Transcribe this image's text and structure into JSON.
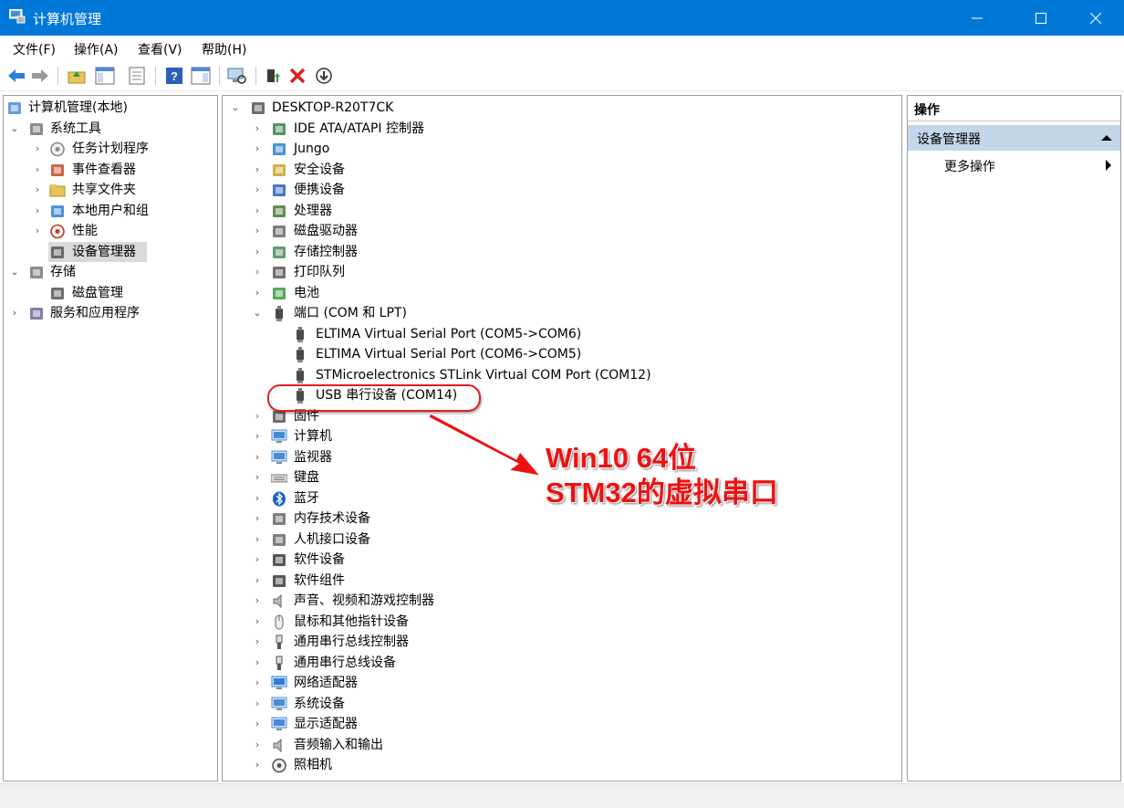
{
  "window": {
    "title": "计算机管理",
    "minimize": "—",
    "maximize": "☐",
    "close": "✕"
  },
  "menu": [
    "文件(F)",
    "操作(A)",
    "查看(V)",
    "帮助(H)"
  ],
  "toolbar": [
    "back-icon",
    "forward-icon",
    "up-folder-icon",
    "show-hide-tree-icon",
    "properties-icon",
    "help-icon",
    "show-action-pane-icon",
    "scan-hardware-icon",
    "update-driver-icon",
    "uninstall-icon",
    "disable-device-icon"
  ],
  "left_tree": [
    {
      "label": "计算机管理(本地)",
      "icon": "computer-management-icon",
      "level": 0,
      "chev": ""
    },
    {
      "label": "系统工具",
      "icon": "tools-icon",
      "level": 1,
      "chev": "⌄"
    },
    {
      "label": "任务计划程序",
      "icon": "clock-icon",
      "level": 2,
      "chev": "›"
    },
    {
      "label": "事件查看器",
      "icon": "event-viewer-icon",
      "level": 2,
      "chev": "›"
    },
    {
      "label": "共享文件夹",
      "icon": "shared-folder-icon",
      "level": 2,
      "chev": "›"
    },
    {
      "label": "本地用户和组",
      "icon": "users-icon",
      "level": 2,
      "chev": "›"
    },
    {
      "label": "性能",
      "icon": "performance-icon",
      "level": 2,
      "chev": "›"
    },
    {
      "label": "设备管理器",
      "icon": "device-manager-icon",
      "level": 2,
      "chev": "",
      "selected": true
    },
    {
      "label": "存储",
      "icon": "storage-icon",
      "level": 1,
      "chev": "⌄"
    },
    {
      "label": "磁盘管理",
      "icon": "disk-management-icon",
      "level": 2,
      "chev": ""
    },
    {
      "label": "服务和应用程序",
      "icon": "services-icon",
      "level": 1,
      "chev": "›"
    }
  ],
  "device_tree": {
    "root": {
      "label": "DESKTOP-R20T7CK",
      "icon": "desktop-computer-icon"
    },
    "categories_top": [
      {
        "label": "IDE ATA/ATAPI 控制器",
        "icon": "ide-controller-icon"
      },
      {
        "label": "Jungo",
        "icon": "jungo-icon"
      },
      {
        "label": "安全设备",
        "icon": "security-device-icon"
      },
      {
        "label": "便携设备",
        "icon": "portable-device-icon"
      },
      {
        "label": "处理器",
        "icon": "processor-icon"
      },
      {
        "label": "磁盘驱动器",
        "icon": "disk-drive-icon"
      },
      {
        "label": "存储控制器",
        "icon": "storage-controller-icon"
      },
      {
        "label": "打印队列",
        "icon": "printer-icon"
      },
      {
        "label": "电池",
        "icon": "battery-icon"
      }
    ],
    "ports": {
      "label": "端口 (COM 和 LPT)",
      "icon": "port-icon",
      "children": [
        "ELTIMA Virtual Serial Port (COM5->COM6)",
        "ELTIMA Virtual Serial Port (COM6->COM5)",
        "STMicroelectronics STLink Virtual COM Port (COM12)",
        "USB 串行设备 (COM14)"
      ]
    },
    "categories_bottom": [
      {
        "label": "固件",
        "icon": "firmware-icon"
      },
      {
        "label": "计算机",
        "icon": "computer-icon"
      },
      {
        "label": "监视器",
        "icon": "monitor-icon"
      },
      {
        "label": "键盘",
        "icon": "keyboard-icon"
      },
      {
        "label": "蓝牙",
        "icon": "bluetooth-icon"
      },
      {
        "label": "内存技术设备",
        "icon": "memory-device-icon"
      },
      {
        "label": "人机接口设备",
        "icon": "hid-icon"
      },
      {
        "label": "软件设备",
        "icon": "software-device-icon"
      },
      {
        "label": "软件组件",
        "icon": "software-component-icon"
      },
      {
        "label": "声音、视频和游戏控制器",
        "icon": "speaker-icon"
      },
      {
        "label": "鼠标和其他指针设备",
        "icon": "mouse-icon"
      },
      {
        "label": "通用串行总线控制器",
        "icon": "usb-controller-icon"
      },
      {
        "label": "通用串行总线设备",
        "icon": "usb-device-icon"
      },
      {
        "label": "网络适配器",
        "icon": "network-adapter-icon"
      },
      {
        "label": "系统设备",
        "icon": "system-device-icon"
      },
      {
        "label": "显示适配器",
        "icon": "display-adapter-icon"
      },
      {
        "label": "音频输入和输出",
        "icon": "audio-io-icon"
      },
      {
        "label": "照相机",
        "icon": "camera-icon"
      }
    ]
  },
  "actions": {
    "header": "操作",
    "section": "设备管理器",
    "more": "更多操作"
  },
  "annotation": {
    "line1": "Win10 64位",
    "line2": "STM32的虚拟串口",
    "color": "#ee1111"
  },
  "colors": {
    "titlebar": "#0078d7",
    "selection": "#d9d9d9",
    "action_section": "#c4d6ea"
  }
}
